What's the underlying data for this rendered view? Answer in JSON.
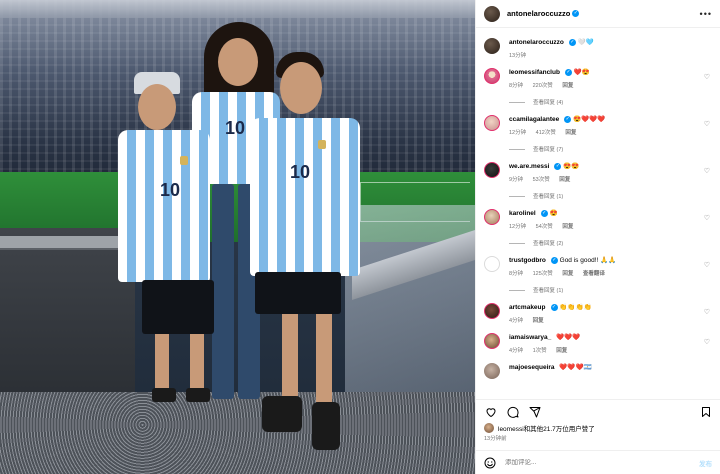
{
  "header": {
    "username": "antonelaroccuzzo",
    "more_icon": "more-horizontal-icon"
  },
  "caption": {
    "username": "antonelaroccuzzo",
    "text": "🤍🩵",
    "time": "13分钟"
  },
  "comments": [
    {
      "username": "leomessifanclub",
      "text": "❤️😍",
      "time": "8分钟",
      "likes": "220次赞",
      "reply": "回复",
      "view_replies": "查看回复 (4)"
    },
    {
      "username": "ccamilagalantee",
      "text": "😍❤️❤️❤️",
      "time": "12分钟",
      "likes": "412次赞",
      "reply": "回复",
      "view_replies": "查看回复 (7)"
    },
    {
      "username": "we.are.messi",
      "text": "😍😍",
      "time": "9分钟",
      "likes": "53次赞",
      "reply": "回复",
      "view_replies": "查看回复 (1)"
    },
    {
      "username": "karolinel",
      "text": "😍",
      "time": "12分钟",
      "likes": "54次赞",
      "reply": "回复",
      "view_replies": "查看回复 (2)"
    },
    {
      "username": "trustgodbro",
      "text": "God is good!! 🙏🙏",
      "time": "8分钟",
      "likes": "125次赞",
      "reply": "回复",
      "translate": "查看翻译",
      "view_replies": "查看回复 (1)"
    },
    {
      "username": "artcmakeup",
      "text": "👏👏👏👏",
      "time": "4分钟",
      "likes": "",
      "reply": "回复"
    },
    {
      "username": "iamaiswarya_",
      "text": "❤️❤️❤️",
      "time": "4分钟",
      "likes": "1次赞",
      "reply": "回复"
    },
    {
      "username": "majoesequeira",
      "text": "❤️❤️❤️🇦🇷",
      "time": "",
      "likes": "",
      "reply": ""
    }
  ],
  "actions": {
    "like_icon": "heart-icon",
    "comment_icon": "comment-icon",
    "share_icon": "share-icon",
    "save_icon": "bookmark-icon"
  },
  "likes_summary": {
    "text": "leomessi和其他21.7万位用户赞了"
  },
  "post_time": "13分钟前",
  "composer": {
    "placeholder": "添加评论...",
    "post_label": "发布",
    "emoji_icon": "smile-icon"
  },
  "colors": {
    "verified": "#0095f6",
    "heart_red": "#ed4956",
    "link_blue_disabled": "#b2dffc",
    "argentina_blue": "#7eb8e6"
  }
}
